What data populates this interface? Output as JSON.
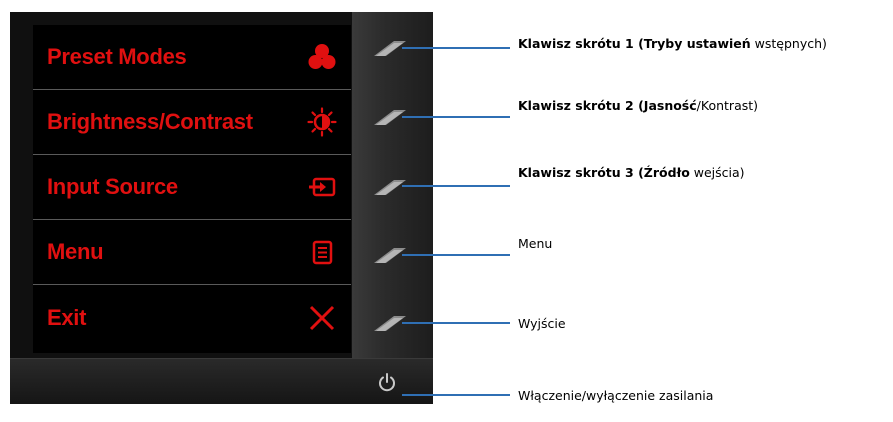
{
  "osd_menu": {
    "items": [
      {
        "label": "Preset Modes",
        "icon": "preset-modes-icon"
      },
      {
        "label": "Brightness/Contrast",
        "icon": "brightness-icon"
      },
      {
        "label": "Input Source",
        "icon": "input-source-icon"
      },
      {
        "label": "Menu",
        "icon": "menu-icon"
      },
      {
        "label": "Exit",
        "icon": "exit-icon"
      }
    ]
  },
  "callouts": {
    "shortcut1": {
      "bold": "Klawisz skrótu 1 (Tryby ustawień",
      "regular": " wstępnych)"
    },
    "shortcut2": {
      "bold": "Klawisz skrótu 2 (Jasność",
      "regular": "/Kontrast)"
    },
    "shortcut3": {
      "bold": "Klawisz skrótu 3 (Źródło",
      "regular": " wejścia)"
    },
    "menu": {
      "regular": "Menu"
    },
    "exit": {
      "regular": "Wyjście"
    },
    "power": {
      "regular": "Włączenie/wyłączenie zasilania"
    }
  },
  "colors": {
    "osd_text": "#e01010",
    "osd_background": "#000000",
    "callout_line": "#2f6fb4"
  }
}
